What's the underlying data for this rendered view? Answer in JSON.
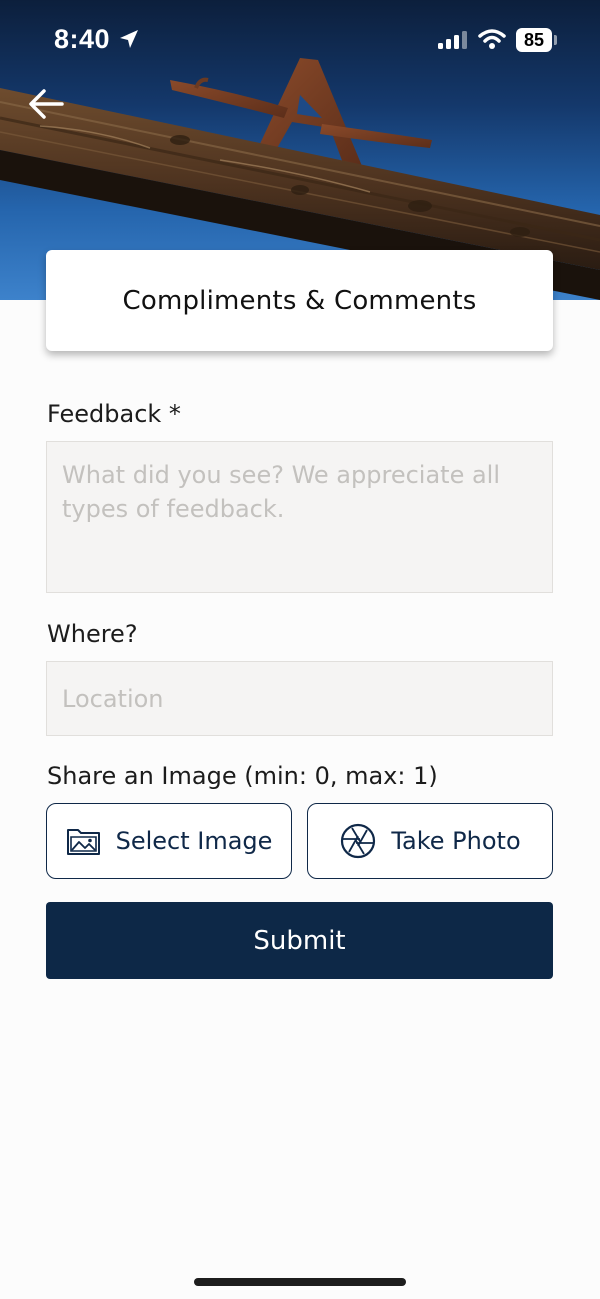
{
  "status_bar": {
    "time": "8:40",
    "battery": "85"
  },
  "header": {
    "back_icon": "arrow-left-icon",
    "title": "Compliments & Comments"
  },
  "form": {
    "feedback": {
      "label": "Feedback *",
      "value": "",
      "placeholder": "What did you see? We appreciate all types of feedback."
    },
    "where": {
      "label": "Where?",
      "value": "",
      "placeholder": "Location"
    },
    "image": {
      "label": "Share an Image (min: 0, max: 1)",
      "select_label": "Select Image",
      "select_icon": "image-folder-icon",
      "photo_label": "Take Photo",
      "photo_icon": "camera-aperture-icon"
    },
    "submit_label": "Submit"
  },
  "colors": {
    "primary": "#0d2847",
    "field_background": "#f5f4f3",
    "placeholder": "#c3c1be",
    "sky": "#2565ad"
  }
}
